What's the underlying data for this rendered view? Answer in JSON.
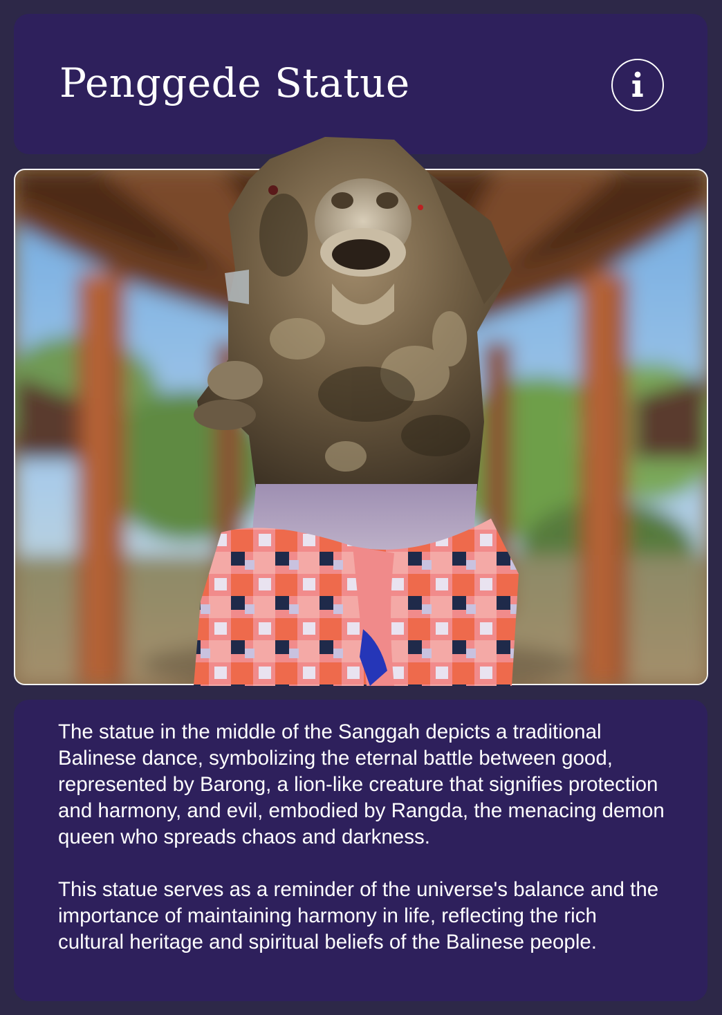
{
  "header": {
    "title": "Penggede Statue",
    "info_icon": "info-circle-icon"
  },
  "scene": {
    "subject": "statue-3d-model",
    "colors": {
      "panel": "#2e205c",
      "background": "#2d2848",
      "text": "#ffffff"
    }
  },
  "description": {
    "paragraphs": [
      "The statue in the middle of the Sanggah depicts a traditional Balinese dance, symbolizing the eternal battle between good, represented by Barong, a lion-like creature that signifies protection and harmony, and evil, embodied by Rangda, the menacing demon queen who spreads chaos and darkness.",
      "This statue serves as a reminder of the universe's balance and the importance of maintaining harmony in life, reflecting the rich cultural heritage and spiritual beliefs of the Balinese people."
    ]
  }
}
